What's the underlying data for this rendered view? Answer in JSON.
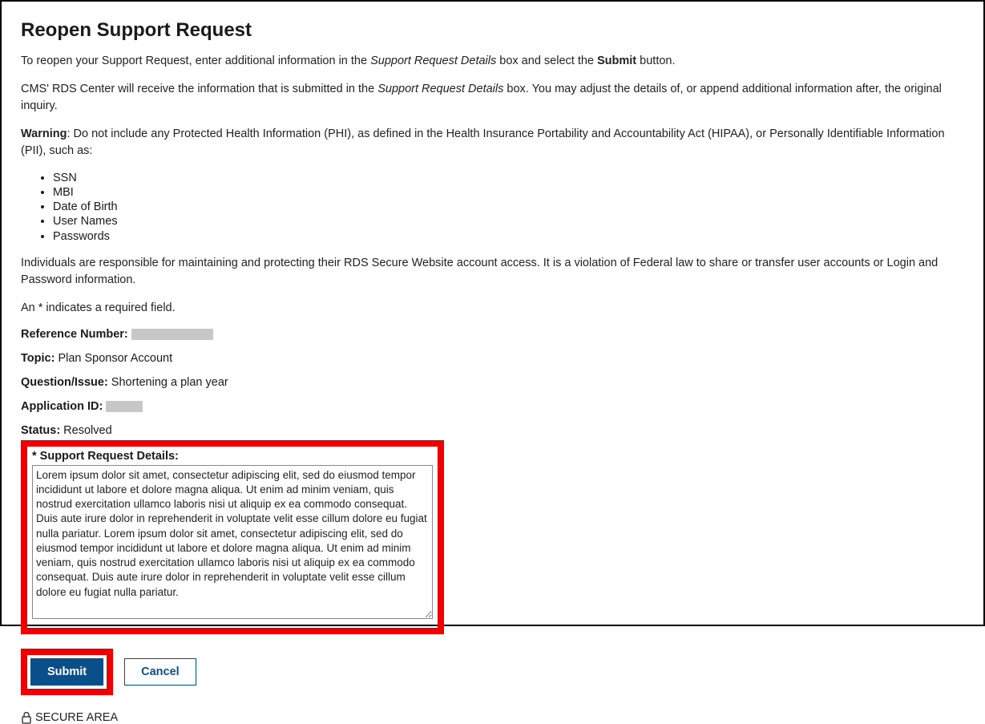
{
  "title": "Reopen Support Request",
  "intro1_pre": "To reopen your Support Request, enter additional information in the ",
  "intro1_italic": "Support Request Details",
  "intro1_mid": " box and select the ",
  "intro1_bold": "Submit",
  "intro1_post": " button.",
  "intro2_pre": "CMS' RDS Center will receive the information that is submitted in the ",
  "intro2_italic": "Support Request Details",
  "intro2_post": " box. You may adjust the details of, or append additional information after, the original inquiry.",
  "warning_label": "Warning",
  "warning_text": ": Do not include any Protected Health Information (PHI), as defined in the Health Insurance Portability and Accountability Act (HIPAA), or Personally Identifiable Information (PII), such as:",
  "phi_items": [
    "SSN",
    "MBI",
    "Date of Birth",
    "User Names",
    "Passwords"
  ],
  "responsibility_text": "Individuals are responsible for maintaining and protecting their RDS Secure Website account access. It is a violation of Federal law to share or transfer user accounts or Login and Password information.",
  "required_note": "An * indicates a required field.",
  "fields": {
    "reference_label": "Reference Number:",
    "topic_label": "Topic:",
    "topic_value": " Plan Sponsor Account",
    "question_label": "Question/Issue:",
    "question_value": " Shortening a plan year",
    "appid_label": "Application ID:",
    "status_label": "Status:",
    "status_value": " Resolved"
  },
  "details_label": "* Support Request Details:",
  "details_value": "Lorem ipsum dolor sit amet, consectetur adipiscing elit, sed do eiusmod tempor incididunt ut labore et dolore magna aliqua. Ut enim ad minim veniam, quis nostrud exercitation ullamco laboris nisi ut aliquip ex ea commodo consequat. Duis aute irure dolor in reprehenderit in voluptate velit esse cillum dolore eu fugiat nulla pariatur. Lorem ipsum dolor sit amet, consectetur adipiscing elit, sed do eiusmod tempor incididunt ut labore et dolore magna aliqua. Ut enim ad minim veniam, quis nostrud exercitation ullamco laboris nisi ut aliquip ex ea commodo consequat. Duis aute irure dolor in reprehenderit in voluptate velit esse cillum dolore eu fugiat nulla pariatur.",
  "buttons": {
    "submit": "Submit",
    "cancel": "Cancel"
  },
  "secure_area": "SECURE AREA"
}
